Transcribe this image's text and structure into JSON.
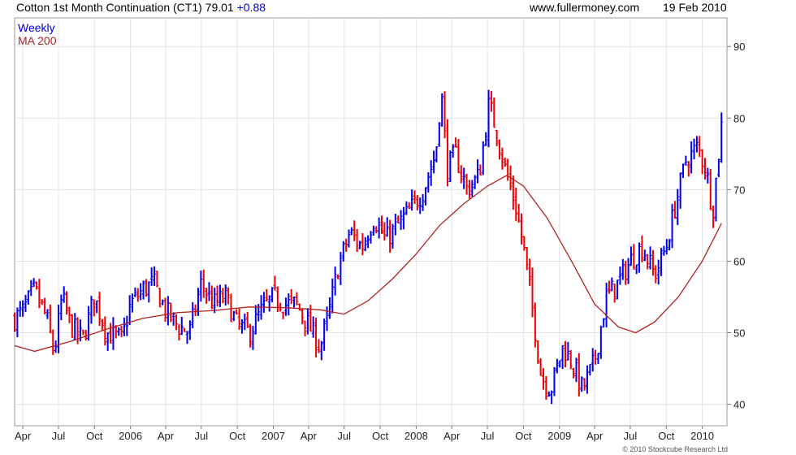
{
  "header": {
    "title": "Cotton 1st Month Continuation (CT1) 79.01",
    "change": "+0.88",
    "site": "www.fullermoney.com",
    "date": "19 Feb 2010"
  },
  "copyright": "© 2010 Stockcube Research Ltd",
  "chart_data": {
    "type": "candlestick",
    "legend": [
      {
        "name": "Weekly",
        "color": "#0000cc"
      },
      {
        "name": "MA 200",
        "color": "#b22222"
      }
    ],
    "legend_position": "top-left",
    "up_color": "#0000ee",
    "down_color": "#ee0000",
    "ma_color": "#b22222",
    "grid": true,
    "ylim": [
      37,
      94
    ],
    "y_ticks": [
      40,
      50,
      60,
      70,
      80,
      90
    ],
    "x_range": [
      "2005-03-11",
      "2010-03-05"
    ],
    "x_ticks": [
      {
        "label": "Apr",
        "date": "2005-04-01"
      },
      {
        "label": "Jul",
        "date": "2005-07-01"
      },
      {
        "label": "Oct",
        "date": "2005-10-01"
      },
      {
        "label": "2006",
        "date": "2006-01-01"
      },
      {
        "label": "Apr",
        "date": "2006-04-01"
      },
      {
        "label": "Jul",
        "date": "2006-07-01"
      },
      {
        "label": "Oct",
        "date": "2006-10-01"
      },
      {
        "label": "2007",
        "date": "2007-01-01"
      },
      {
        "label": "Apr",
        "date": "2007-04-01"
      },
      {
        "label": "Jul",
        "date": "2007-07-01"
      },
      {
        "label": "Oct",
        "date": "2007-10-01"
      },
      {
        "label": "2008",
        "date": "2008-01-01"
      },
      {
        "label": "Apr",
        "date": "2008-04-01"
      },
      {
        "label": "Jul",
        "date": "2008-07-01"
      },
      {
        "label": "Oct",
        "date": "2008-10-01"
      },
      {
        "label": "2009",
        "date": "2009-01-01"
      },
      {
        "label": "Apr",
        "date": "2009-04-01"
      },
      {
        "label": "Jul",
        "date": "2009-07-01"
      },
      {
        "label": "Oct",
        "date": "2009-10-01"
      },
      {
        "label": "2010",
        "date": "2010-01-01"
      }
    ],
    "close_path": [
      [
        "2005-03-11",
        52
      ],
      [
        "2005-04-01",
        53
      ],
      [
        "2005-05-01",
        56
      ],
      [
        "2005-06-01",
        52
      ],
      [
        "2005-06-20",
        47
      ],
      [
        "2005-07-10",
        55
      ],
      [
        "2005-08-01",
        51
      ],
      [
        "2005-09-01",
        49
      ],
      [
        "2005-10-01",
        55
      ],
      [
        "2005-11-01",
        50
      ],
      [
        "2005-12-10",
        49
      ],
      [
        "2006-01-01",
        54
      ],
      [
        "2006-02-01",
        56
      ],
      [
        "2006-03-01",
        57
      ],
      [
        "2006-04-01",
        53
      ],
      [
        "2006-05-01",
        51
      ],
      [
        "2006-06-01",
        50
      ],
      [
        "2006-07-01",
        57
      ],
      [
        "2006-08-01",
        54
      ],
      [
        "2006-09-01",
        55
      ],
      [
        "2006-10-01",
        51
      ],
      [
        "2006-11-01",
        50
      ],
      [
        "2006-12-01",
        53
      ],
      [
        "2007-01-01",
        55
      ],
      [
        "2007-02-01",
        54
      ],
      [
        "2007-03-01",
        54
      ],
      [
        "2007-04-01",
        51
      ],
      [
        "2007-05-01",
        48
      ],
      [
        "2007-05-20",
        52
      ],
      [
        "2007-06-15",
        59
      ],
      [
        "2007-07-15",
        64
      ],
      [
        "2007-08-15",
        62
      ],
      [
        "2007-09-15",
        66
      ],
      [
        "2007-10-15",
        63
      ],
      [
        "2007-11-15",
        65
      ],
      [
        "2007-12-15",
        67
      ],
      [
        "2008-01-20",
        70
      ],
      [
        "2008-02-20",
        75
      ],
      [
        "2008-03-05",
        84
      ],
      [
        "2008-03-20",
        73
      ],
      [
        "2008-04-10",
        75
      ],
      [
        "2008-05-10",
        70
      ],
      [
        "2008-06-10",
        72
      ],
      [
        "2008-07-05",
        82
      ],
      [
        "2008-07-25",
        78
      ],
      [
        "2008-08-15",
        73
      ],
      [
        "2008-09-10",
        68
      ],
      [
        "2008-10-01",
        62
      ],
      [
        "2008-10-20",
        55
      ],
      [
        "2008-11-15",
        44
      ],
      [
        "2008-12-10",
        42
      ],
      [
        "2009-01-10",
        48
      ],
      [
        "2009-02-01",
        46
      ],
      [
        "2009-03-01",
        42
      ],
      [
        "2009-04-01",
        46
      ],
      [
        "2009-05-01",
        55
      ],
      [
        "2009-06-01",
        57
      ],
      [
        "2009-07-01",
        60
      ],
      [
        "2009-08-01",
        62
      ],
      [
        "2009-09-01",
        58
      ],
      [
        "2009-10-01",
        62
      ],
      [
        "2009-10-25",
        68
      ],
      [
        "2009-11-20",
        74
      ],
      [
        "2009-12-20",
        76
      ],
      [
        "2010-01-10",
        73
      ],
      [
        "2010-01-28",
        67
      ],
      [
        "2010-02-10",
        74
      ],
      [
        "2010-02-19",
        79
      ]
    ],
    "ma200_path": [
      [
        "2005-03-11",
        48.2
      ],
      [
        "2005-05-01",
        47.4
      ],
      [
        "2005-08-01",
        48.8
      ],
      [
        "2005-11-01",
        50.5
      ],
      [
        "2006-02-01",
        52.0
      ],
      [
        "2006-05-01",
        52.8
      ],
      [
        "2006-08-01",
        53.1
      ],
      [
        "2006-11-01",
        53.6
      ],
      [
        "2007-02-01",
        53.5
      ],
      [
        "2007-05-01",
        53.2
      ],
      [
        "2007-07-01",
        52.6
      ],
      [
        "2007-09-01",
        54.5
      ],
      [
        "2007-11-01",
        57.5
      ],
      [
        "2008-01-01",
        61.0
      ],
      [
        "2008-03-01",
        65.0
      ],
      [
        "2008-05-01",
        68.0
      ],
      [
        "2008-07-01",
        70.5
      ],
      [
        "2008-08-20",
        72.0
      ],
      [
        "2008-10-01",
        70.5
      ],
      [
        "2008-12-01",
        66.0
      ],
      [
        "2009-02-01",
        60.0
      ],
      [
        "2009-04-01",
        54.0
      ],
      [
        "2009-06-01",
        50.8
      ],
      [
        "2009-07-15",
        50.0
      ],
      [
        "2009-09-01",
        51.5
      ],
      [
        "2009-11-01",
        55.0
      ],
      [
        "2010-01-01",
        60.0
      ],
      [
        "2010-02-19",
        65.3
      ]
    ]
  }
}
